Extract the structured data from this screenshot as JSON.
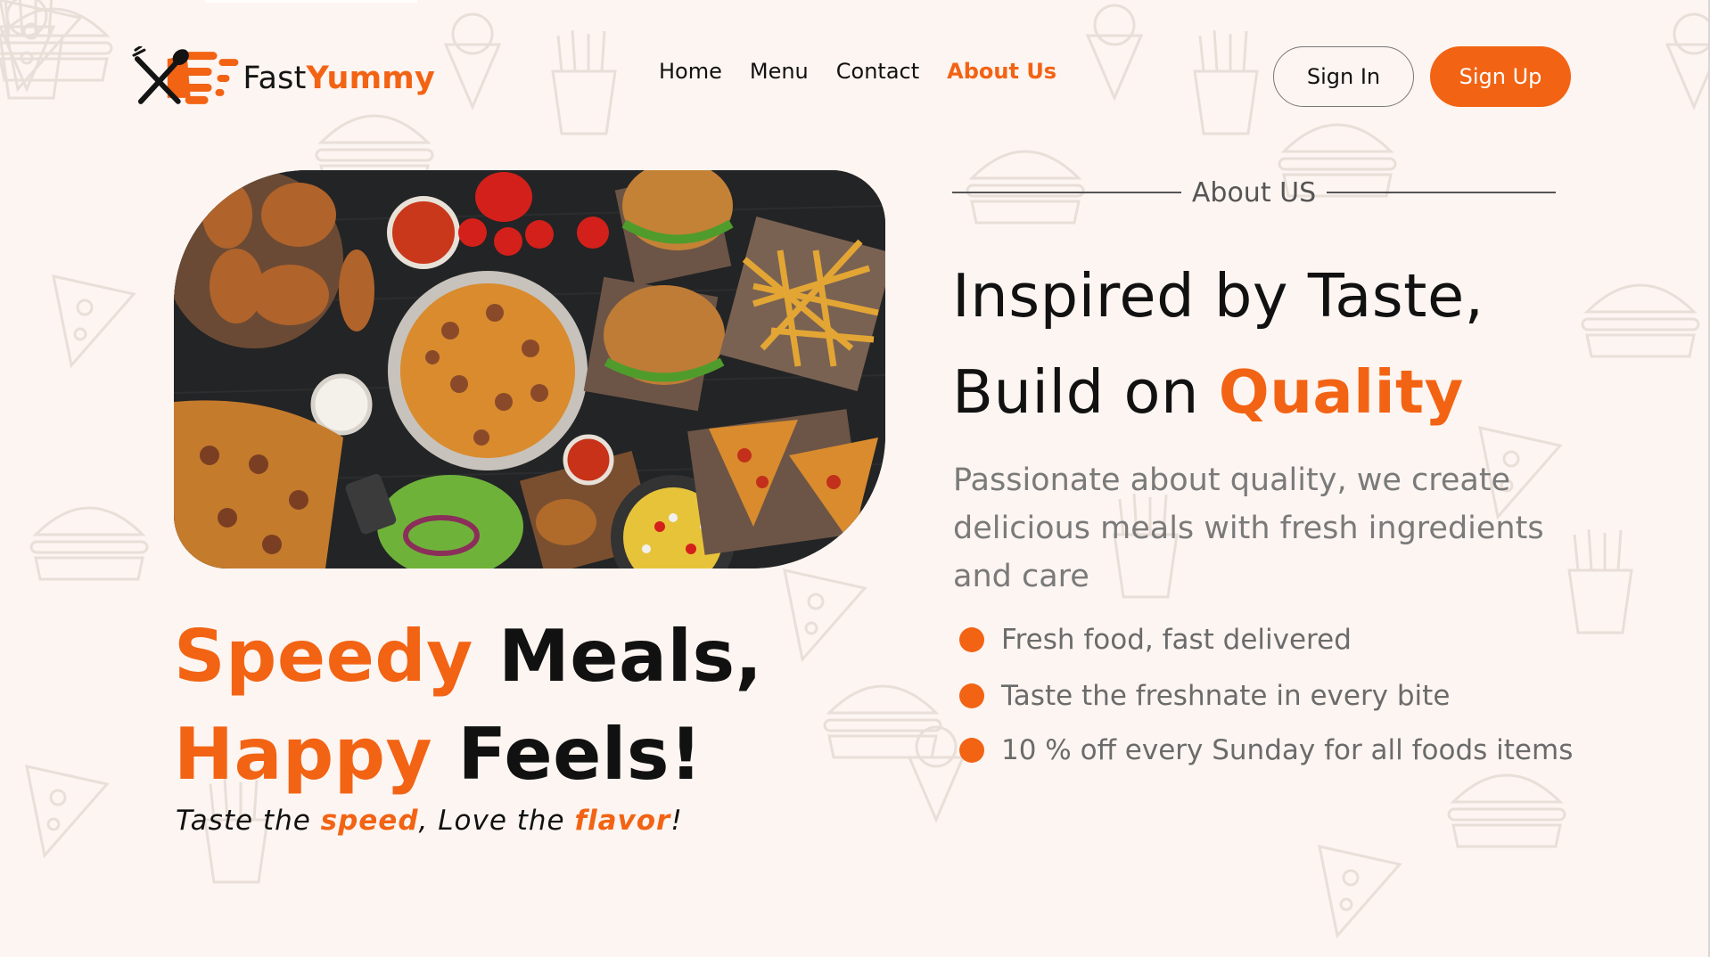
{
  "brand": {
    "name_part1": "Fast",
    "name_part2": "Yummy",
    "accent_color": "#f26314"
  },
  "nav": {
    "items": [
      {
        "label": "Home",
        "active": false
      },
      {
        "label": "Menu",
        "active": false
      },
      {
        "label": "Contact",
        "active": false
      },
      {
        "label": "About Us",
        "active": true
      }
    ]
  },
  "auth": {
    "sign_in_label": "Sign In",
    "sign_up_label": "Sign Up"
  },
  "hero": {
    "image_icon": "food-platter-photo",
    "headline": {
      "line1_accent": "Speedy",
      "line1_rest": " Meals,",
      "line2_accent": "Happy",
      "line2_rest": " Feels!"
    },
    "tagline": {
      "part1": "Taste the ",
      "hl1": "speed",
      "part2": ", Love the ",
      "hl2": "flavor",
      "part3": "!"
    }
  },
  "about": {
    "eyebrow": "About US",
    "title_line1": "Inspired by Taste,",
    "title_line2_plain": "Build on ",
    "title_line2_accent": "Quality",
    "description": "Passionate about quality, we create delicious meals with fresh ingredients and care",
    "features": [
      "Fresh food, fast delivered",
      "Taste the freshnate in every bite",
      "10 % off every Sunday for all foods items"
    ]
  }
}
